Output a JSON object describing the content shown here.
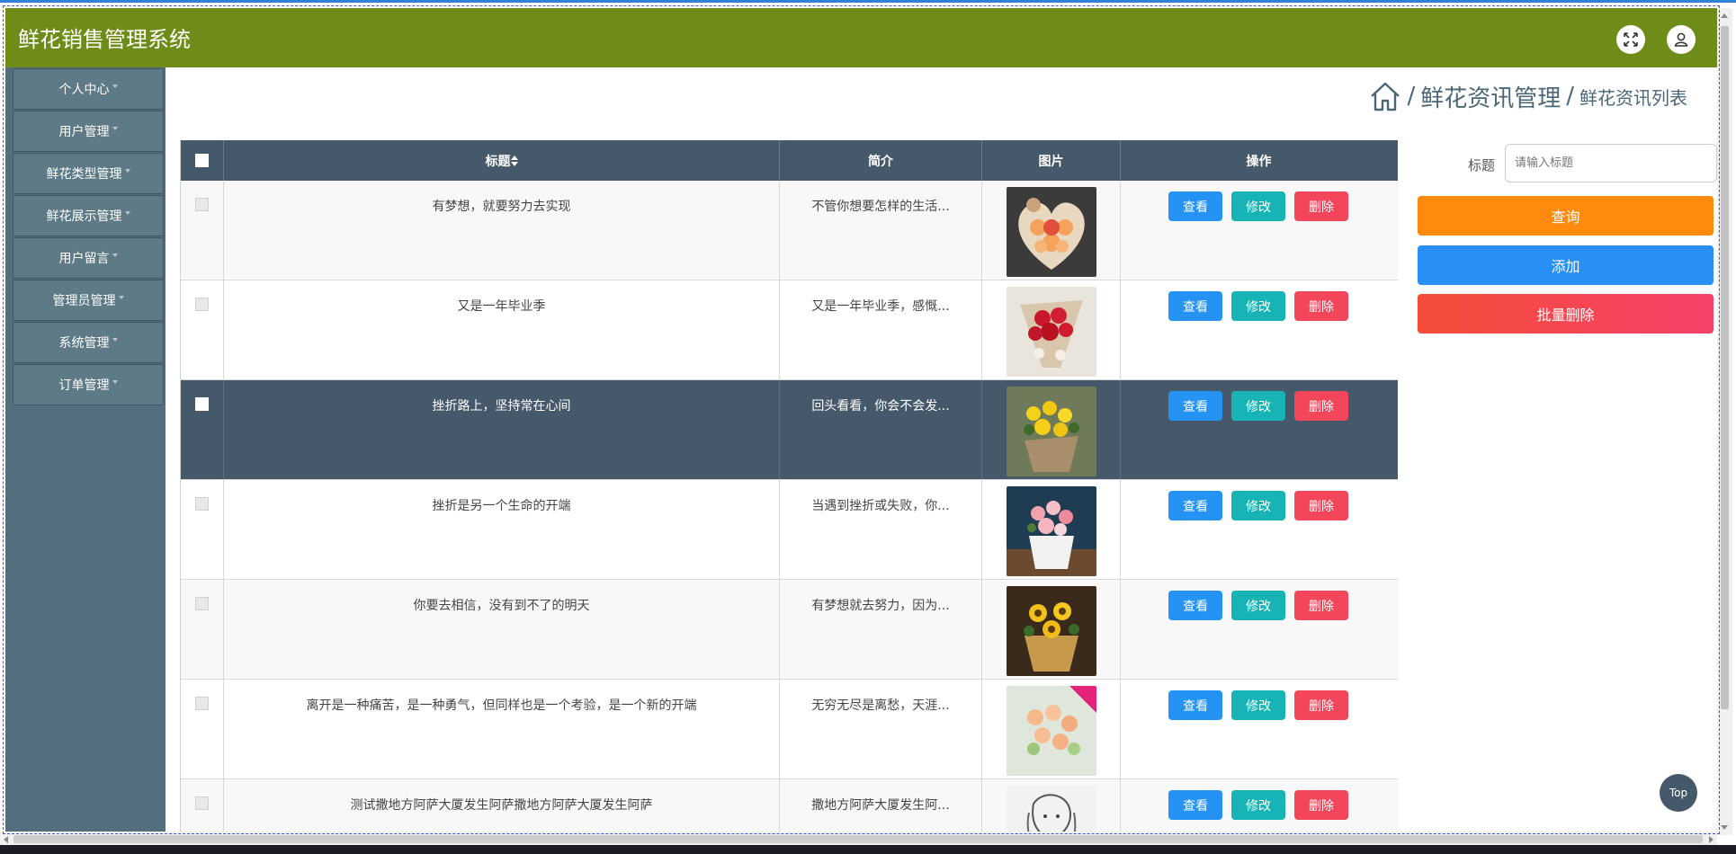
{
  "header": {
    "title": "鲜花销售管理系统"
  },
  "colors": {
    "header_bg": "#6e8c17",
    "sidebar_bg": "#536f7d",
    "view_btn": "#2593f3",
    "edit_btn": "#17b3b5",
    "delete_btn": "#f4465a",
    "query_btn": "#fe8a0e",
    "add_btn": "#2a8ff5",
    "batch_delete_btn": "#f64d4d"
  },
  "sidebar": {
    "items": [
      {
        "label": "个人中心"
      },
      {
        "label": "用户管理"
      },
      {
        "label": "鲜花类型管理"
      },
      {
        "label": "鲜花展示管理"
      },
      {
        "label": "用户留言"
      },
      {
        "label": "管理员管理"
      },
      {
        "label": "系统管理"
      },
      {
        "label": "订单管理"
      }
    ]
  },
  "breadcrumb": {
    "separator": "/",
    "section": "鲜花资讯管理",
    "page": "鲜花资讯列表"
  },
  "table": {
    "headers": {
      "title": "标题",
      "intro": "简介",
      "image": "图片",
      "actions": "操作"
    },
    "actions": {
      "view": "查看",
      "edit": "修改",
      "delete": "删除"
    },
    "rows": [
      {
        "title": "有梦想，就要努力去实现",
        "intro": "不管你想要怎样的生活...",
        "image": "heart-flower-box"
      },
      {
        "title": "又是一年毕业季",
        "intro": "又是一年毕业季，感慨...",
        "image": "rose-bouquet"
      },
      {
        "title": "挫折路上，坚持常在心间",
        "intro": "回头看看，你会不会发...",
        "image": "yellow-bouquet"
      },
      {
        "title": "挫折是另一个生命的开端",
        "intro": "当遇到挫折或失败，你...",
        "image": "pink-bouquet"
      },
      {
        "title": "你要去相信，没有到不了的明天",
        "intro": "有梦想就去努力，因为...",
        "image": "sunflower-bouquet"
      },
      {
        "title": "离开是一种痛苦，是一种勇气，但同样也是一个考验，是一个新的开端",
        "intro": "无穷无尽是离愁，天涯...",
        "image": "peach-rose-bouquet"
      },
      {
        "title": "测试撒地方阿萨大厦发生阿萨撒地方阿萨大厦发生阿萨",
        "intro": "撒地方阿萨大厦发生阿...",
        "image": "sketch-portrait"
      }
    ]
  },
  "search": {
    "label": "标题",
    "placeholder": "请输入标题"
  },
  "buttons": {
    "query": "查询",
    "add": "添加",
    "batch_delete": "批量删除"
  },
  "top_button": "Top"
}
